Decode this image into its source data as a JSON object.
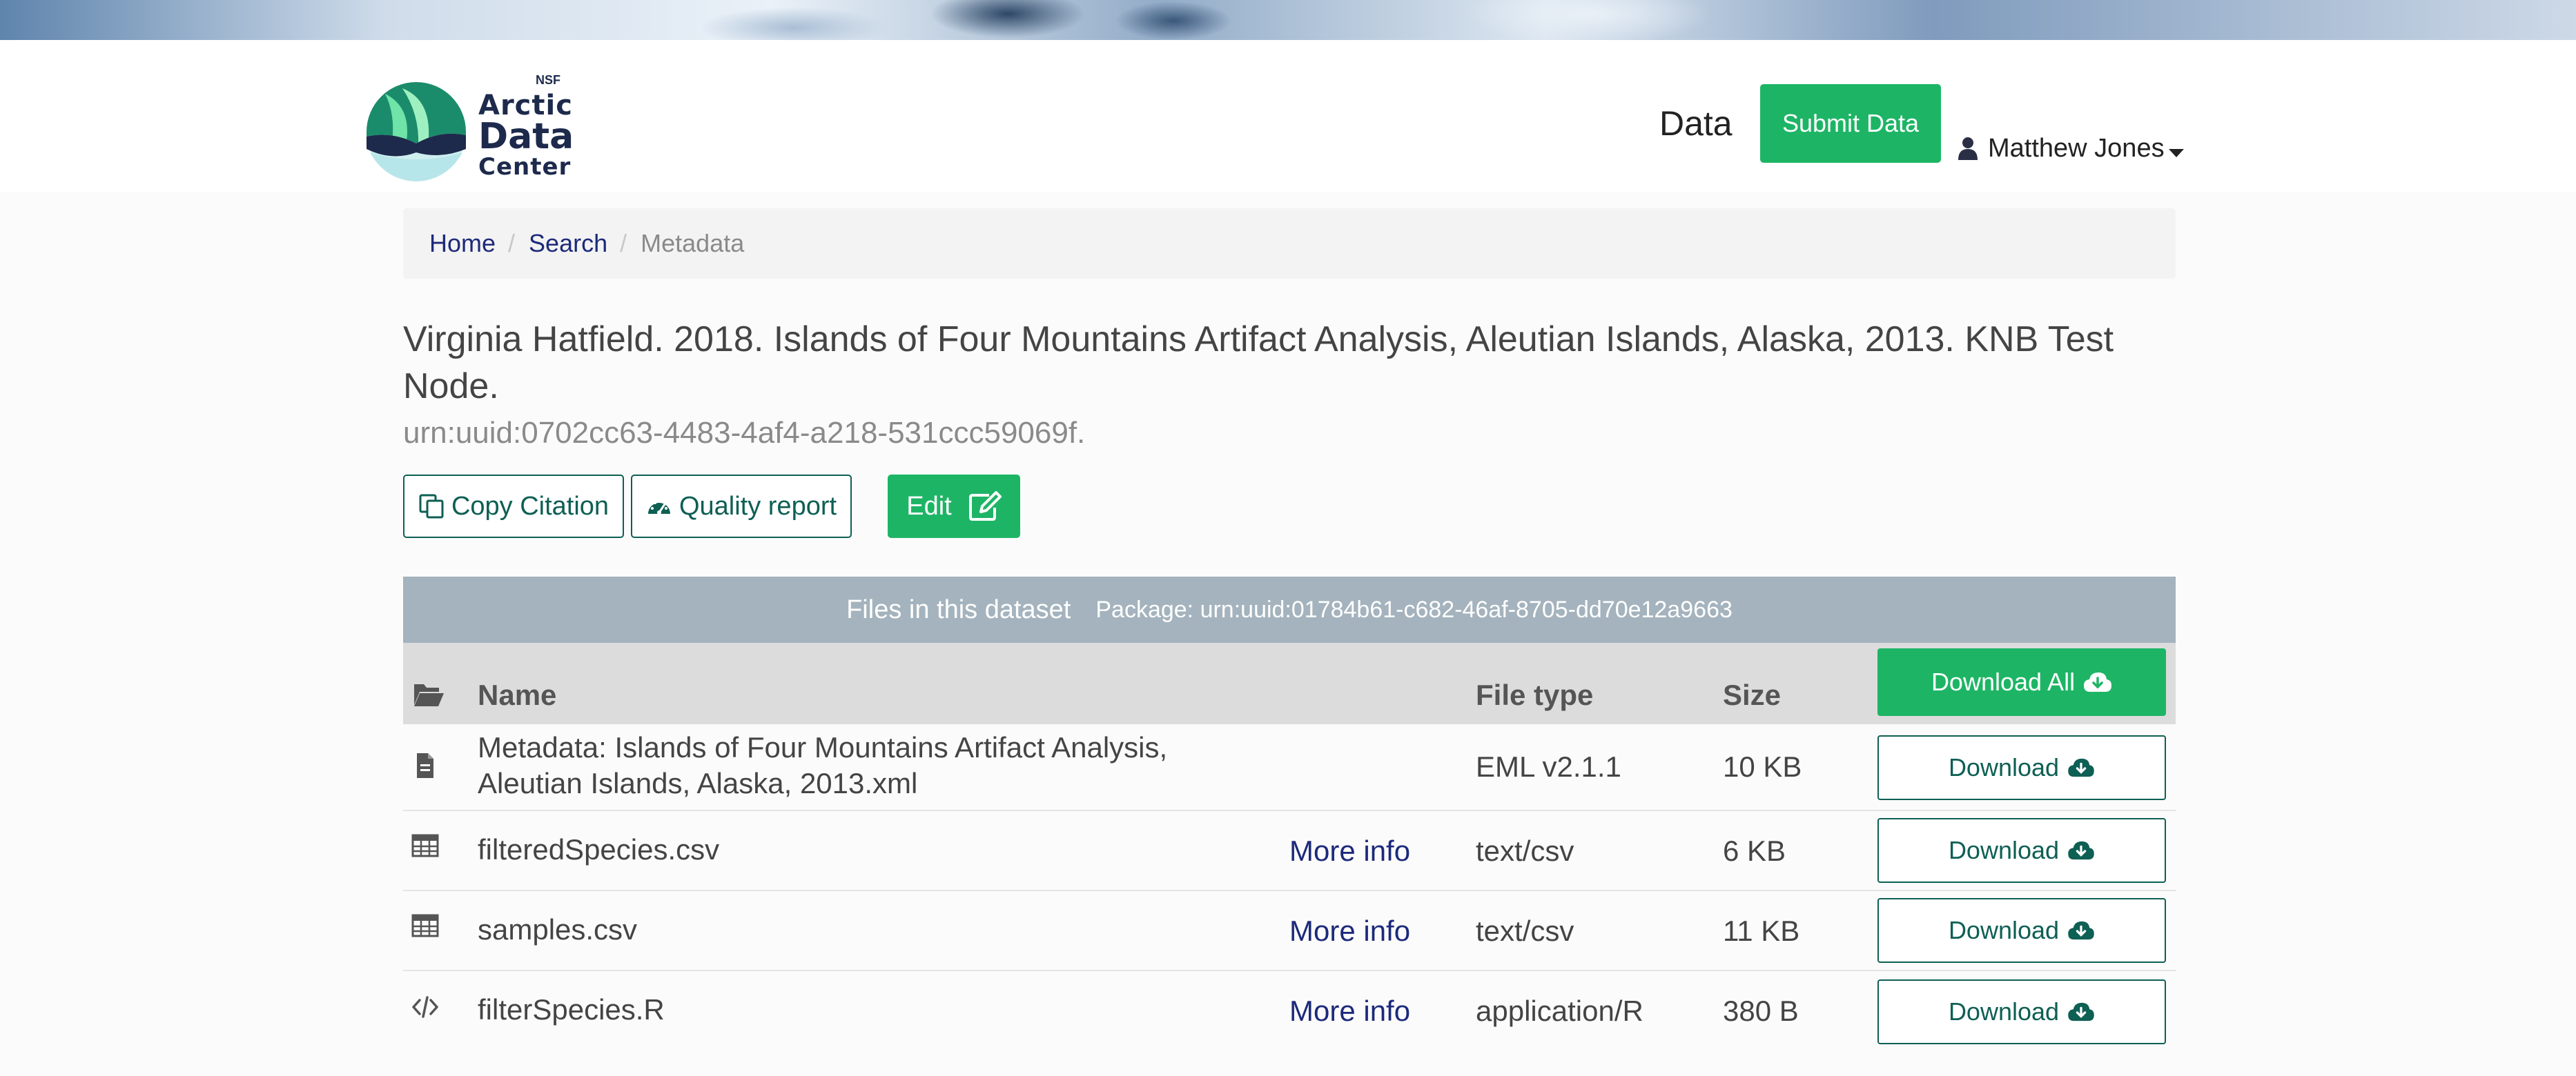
{
  "header": {
    "logo": {
      "nsf": "NSF",
      "line1": "Arctic",
      "line2": "Data",
      "line3": "Center"
    },
    "nav_data": "Data",
    "submit_label": "Submit Data",
    "user_name": "Matthew Jones"
  },
  "breadcrumb": {
    "home": "Home",
    "sep": "/",
    "search": "Search",
    "current": "Metadata"
  },
  "citation": {
    "text": "Virginia Hatfield. 2018. Islands of Four Mountains Artifact Analysis, Aleutian Islands, Alaska, 2013. KNB Test Node.",
    "identifier": "urn:uuid:0702cc63-4483-4af4-a218-531ccc59069f."
  },
  "actions": {
    "copy_citation": "Copy Citation",
    "quality_report": "Quality report",
    "edit": "Edit"
  },
  "files": {
    "title": "Files in this dataset",
    "package": "Package: urn:uuid:01784b61-c682-46af-8705-dd70e12a9663",
    "columns": {
      "name": "Name",
      "type": "File type",
      "size": "Size"
    },
    "download_all": "Download All",
    "more_info": "More info",
    "download": "Download",
    "rows": [
      {
        "icon": "document-icon",
        "name": "Metadata: Islands of Four Mountains Artifact Analysis, Aleutian Islands, Alaska, 2013.xml",
        "more_info": "",
        "type": "EML v2.1.1",
        "size": "10 KB"
      },
      {
        "icon": "table-icon",
        "name": "filteredSpecies.csv",
        "more_info": "More info",
        "type": "text/csv",
        "size": "6 KB"
      },
      {
        "icon": "table-icon",
        "name": "samples.csv",
        "more_info": "More info",
        "type": "text/csv",
        "size": "11 KB"
      },
      {
        "icon": "code-icon",
        "name": "filterSpecies.R",
        "more_info": "More info",
        "type": "application/R",
        "size": "380 B"
      }
    ]
  },
  "colors": {
    "brand_green": "#1db565",
    "outline_teal": "#0e5f54",
    "link_navy": "#1d2a7a",
    "files_header": "#a4b3bd"
  }
}
